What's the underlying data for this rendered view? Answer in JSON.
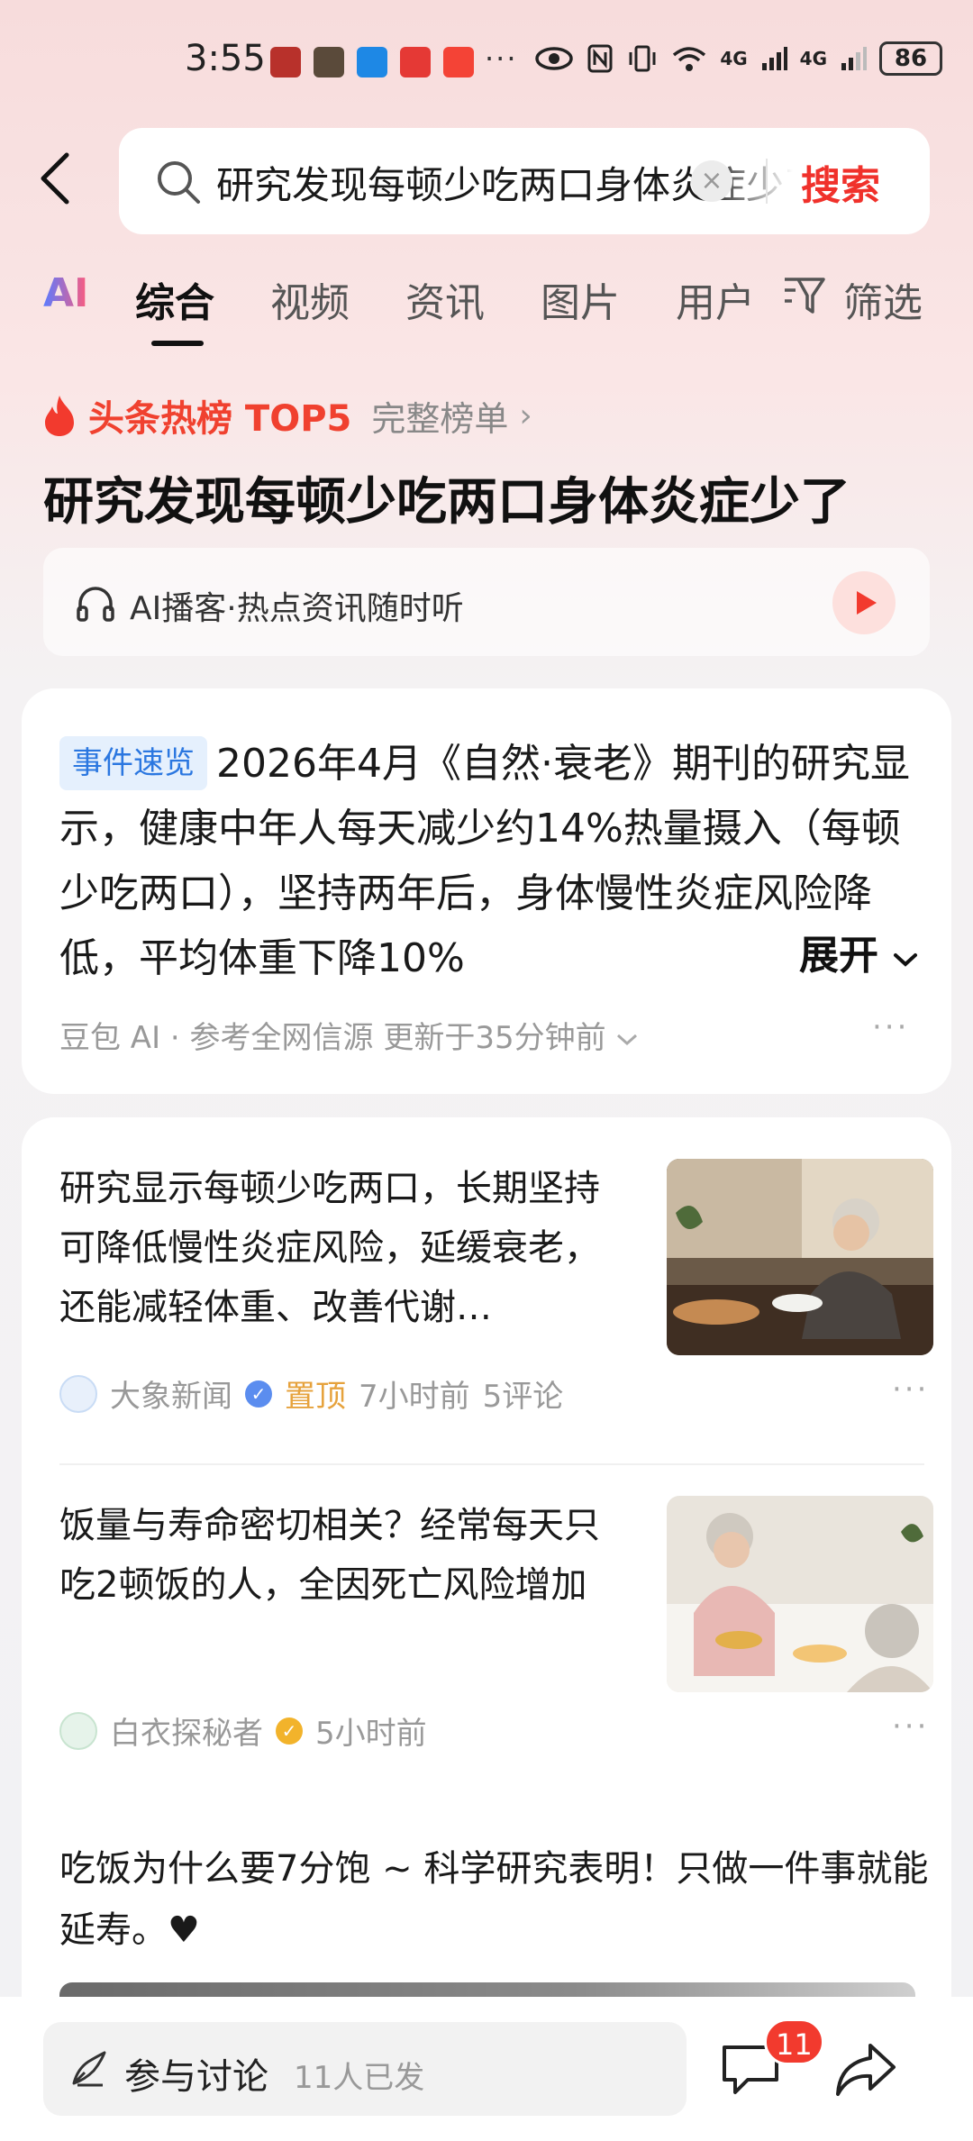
{
  "status_bar": {
    "time": "3:55",
    "overflow": "···",
    "network_1": "4G",
    "network_2": "4G",
    "battery": "86"
  },
  "search": {
    "query": "研究发现每顿少吃两口身体炎症少了",
    "submit_label": "搜索"
  },
  "tabs": [
    {
      "label": "AI"
    },
    {
      "label": "综合"
    },
    {
      "label": "视频"
    },
    {
      "label": "资讯"
    },
    {
      "label": "图片"
    },
    {
      "label": "用户"
    },
    {
      "label": "筛选"
    }
  ],
  "hot": {
    "label": "头条热榜 TOP5",
    "full_list": "完整榜单",
    "chevron": "›",
    "headline": "研究发现每顿少吃两口身体炎症少了"
  },
  "podcast": {
    "text": "AI播客·热点资讯随时听"
  },
  "summary": {
    "badge": "事件速览",
    "text": "2026年4月《自然·衰老》期刊的研究显示，健康中年人每天减少约14%热量摄入（每顿少吃两口），坚持两年后，身体慢性炎症风险降低，平均体重下降10%",
    "expand": "展开",
    "source": "豆包 AI · 参考全网信源 更新于35分钟前",
    "more": "···"
  },
  "articles": [
    {
      "title": "研究显示每顿少吃两口，长期坚持可降低慢性炎症风险，延缓衰老，还能减轻体重、改善代谢…",
      "author": "大象新闻",
      "pinned": "置顶",
      "time": "7小时前",
      "comments": "5评论",
      "verified_color": "#5b8def",
      "more": "···"
    },
    {
      "title": "饭量与寿命密切相关？经常每天只吃2顿饭的人，全因死亡风险增加",
      "author": "白衣探秘者",
      "time": "5小时前",
      "verified_color": "#f2b32b",
      "more": "···"
    },
    {
      "title": "吃饭为什么要7分饱 ~ 科学研究表明！只做一件事就能延寿。♥"
    }
  ],
  "bottom": {
    "discuss_label": "参与讨论",
    "discuss_count": "11人已发",
    "comment_badge": "11"
  },
  "colors": {
    "accent_red": "#f0312b",
    "badge_blue": "#2b77e0",
    "pinned_orange": "#e6a23c"
  }
}
